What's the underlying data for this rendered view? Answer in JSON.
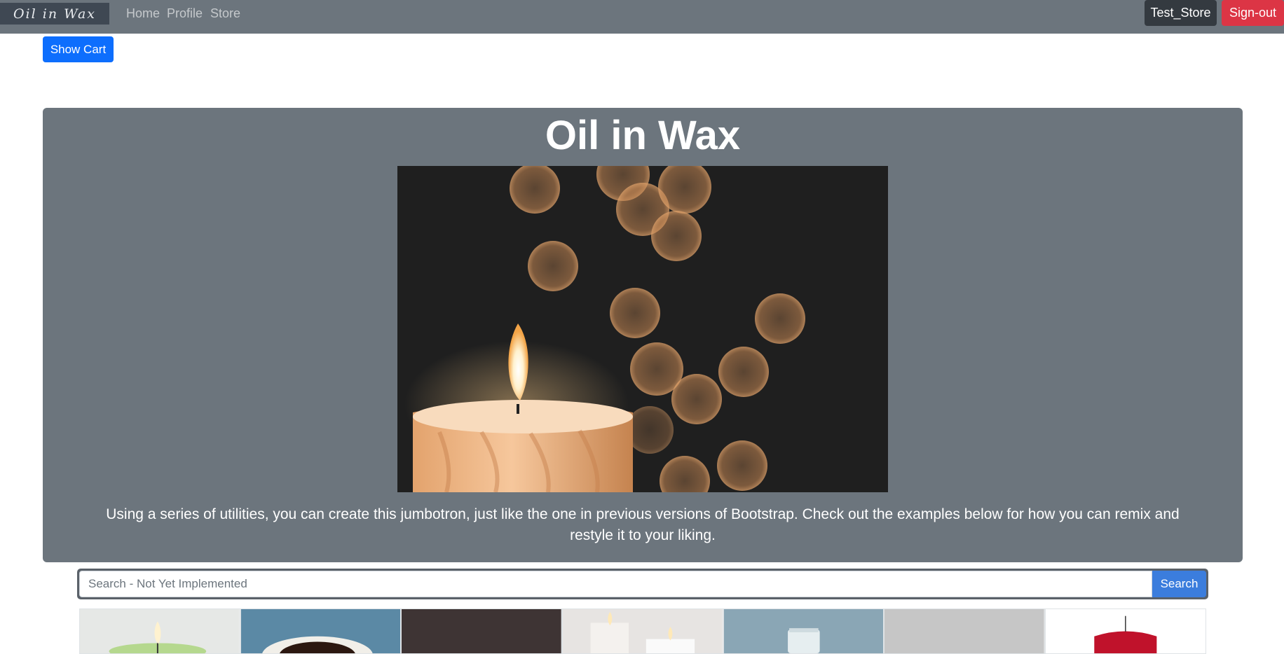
{
  "navbar": {
    "brand": "Oil in Wax",
    "links": [
      "Home",
      "Profile",
      "Store"
    ],
    "user_button": "Test_Store",
    "signout_button": "Sign-out"
  },
  "cart": {
    "label": "Show Cart"
  },
  "jumbotron": {
    "title": "Oil in Wax",
    "image": "candle-bokeh-image",
    "lead": "Using a series of utilities, you can create this jumbotron, just like the one in previous versions of Bootstrap. Check out the examples below for how you can remix and restyle it to your liking."
  },
  "search": {
    "placeholder": "Search - Not Yet Implemented",
    "button": "Search"
  },
  "products": [
    {
      "image": "green-candle"
    },
    {
      "image": "coffee-cup"
    },
    {
      "image": "dark-tile"
    },
    {
      "image": "white-candles"
    },
    {
      "image": "glass-jar"
    },
    {
      "image": "placeholder"
    },
    {
      "image": "red-candle"
    }
  ],
  "colors": {
    "navbar": "#6c757d",
    "primary": "#0d6efd",
    "danger": "#dc3545",
    "dark": "#343a40"
  }
}
